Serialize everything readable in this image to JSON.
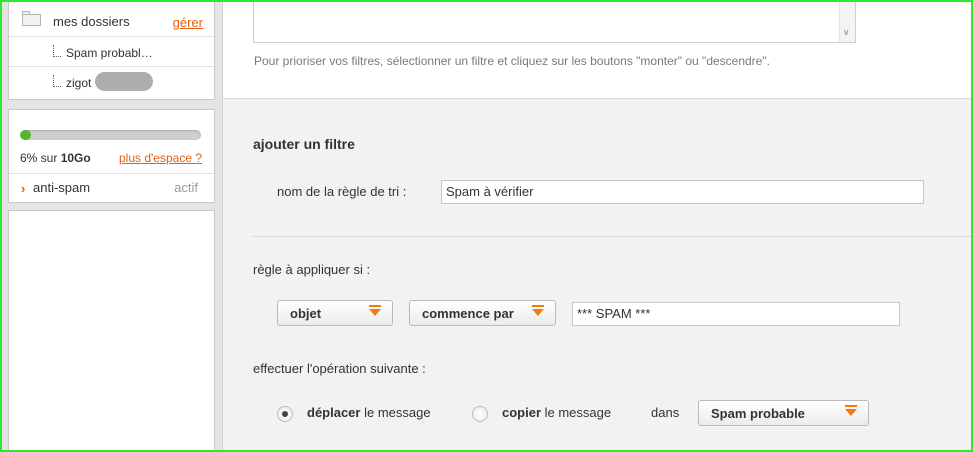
{
  "sidebar": {
    "folders": {
      "title": "mes dossiers",
      "manage_link": "gérer",
      "items": [
        {
          "label": "Spam probabl…"
        },
        {
          "label": "zigot"
        }
      ]
    },
    "quota": {
      "used_fraction": 0.06,
      "percent_text": "6% sur ",
      "capacity_text": "10Go",
      "more_space_link": "plus d'espace ?"
    },
    "antispam": {
      "arrow": "›",
      "label": "anti-spam",
      "status": "actif"
    }
  },
  "main": {
    "priority_hint": "Pour prioriser vos filtres, sélectionner un filtre et cliquez sur les boutons \"monter\" ou \"descendre\".",
    "add_filter": {
      "title": "ajouter un filtre",
      "rule_name_label": "nom de la règle de tri :",
      "rule_name_value": "Spam à vérifier",
      "condition_label": "règle à appliquer si :",
      "field_select": "objet",
      "operator_select": "commence par",
      "condition_value": "*** SPAM ***",
      "operation_label": "effectuer l'opération suivante :",
      "move_option": {
        "bold": "déplacer",
        "rest": " le message",
        "checked": true
      },
      "copy_option": {
        "bold": "copier",
        "rest": " le message",
        "checked": false
      },
      "in_label": "dans",
      "target_folder": "Spam probable"
    }
  },
  "colors": {
    "accent_orange": "#e35f12",
    "quota_green": "#55b52b",
    "frame_green": "#2ee82e"
  }
}
